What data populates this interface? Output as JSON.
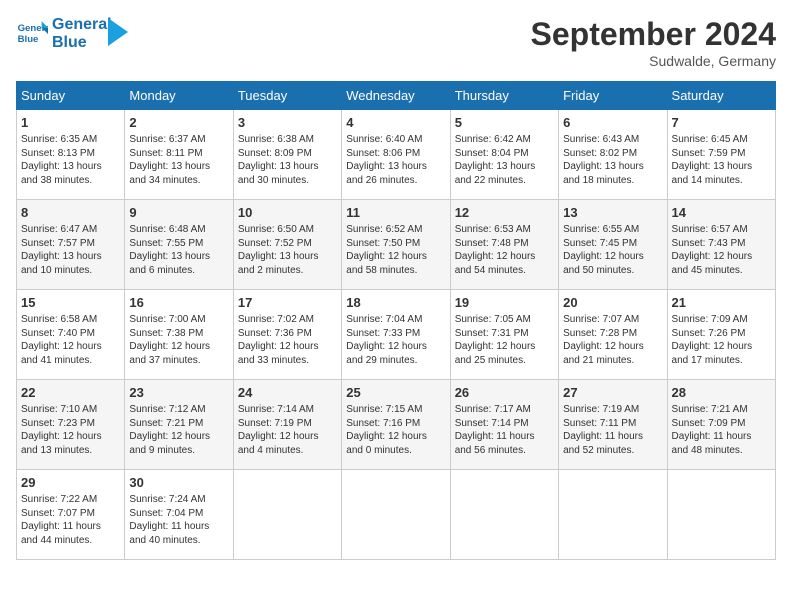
{
  "header": {
    "logo_line1": "General",
    "logo_line2": "Blue",
    "month": "September 2024",
    "location": "Sudwalde, Germany"
  },
  "weekdays": [
    "Sunday",
    "Monday",
    "Tuesday",
    "Wednesday",
    "Thursday",
    "Friday",
    "Saturday"
  ],
  "weeks": [
    [
      {
        "day": "1",
        "lines": [
          "Sunrise: 6:35 AM",
          "Sunset: 8:13 PM",
          "Daylight: 13 hours",
          "and 38 minutes."
        ]
      },
      {
        "day": "2",
        "lines": [
          "Sunrise: 6:37 AM",
          "Sunset: 8:11 PM",
          "Daylight: 13 hours",
          "and 34 minutes."
        ]
      },
      {
        "day": "3",
        "lines": [
          "Sunrise: 6:38 AM",
          "Sunset: 8:09 PM",
          "Daylight: 13 hours",
          "and 30 minutes."
        ]
      },
      {
        "day": "4",
        "lines": [
          "Sunrise: 6:40 AM",
          "Sunset: 8:06 PM",
          "Daylight: 13 hours",
          "and 26 minutes."
        ]
      },
      {
        "day": "5",
        "lines": [
          "Sunrise: 6:42 AM",
          "Sunset: 8:04 PM",
          "Daylight: 13 hours",
          "and 22 minutes."
        ]
      },
      {
        "day": "6",
        "lines": [
          "Sunrise: 6:43 AM",
          "Sunset: 8:02 PM",
          "Daylight: 13 hours",
          "and 18 minutes."
        ]
      },
      {
        "day": "7",
        "lines": [
          "Sunrise: 6:45 AM",
          "Sunset: 7:59 PM",
          "Daylight: 13 hours",
          "and 14 minutes."
        ]
      }
    ],
    [
      {
        "day": "8",
        "lines": [
          "Sunrise: 6:47 AM",
          "Sunset: 7:57 PM",
          "Daylight: 13 hours",
          "and 10 minutes."
        ]
      },
      {
        "day": "9",
        "lines": [
          "Sunrise: 6:48 AM",
          "Sunset: 7:55 PM",
          "Daylight: 13 hours",
          "and 6 minutes."
        ]
      },
      {
        "day": "10",
        "lines": [
          "Sunrise: 6:50 AM",
          "Sunset: 7:52 PM",
          "Daylight: 13 hours",
          "and 2 minutes."
        ]
      },
      {
        "day": "11",
        "lines": [
          "Sunrise: 6:52 AM",
          "Sunset: 7:50 PM",
          "Daylight: 12 hours",
          "and 58 minutes."
        ]
      },
      {
        "day": "12",
        "lines": [
          "Sunrise: 6:53 AM",
          "Sunset: 7:48 PM",
          "Daylight: 12 hours",
          "and 54 minutes."
        ]
      },
      {
        "day": "13",
        "lines": [
          "Sunrise: 6:55 AM",
          "Sunset: 7:45 PM",
          "Daylight: 12 hours",
          "and 50 minutes."
        ]
      },
      {
        "day": "14",
        "lines": [
          "Sunrise: 6:57 AM",
          "Sunset: 7:43 PM",
          "Daylight: 12 hours",
          "and 45 minutes."
        ]
      }
    ],
    [
      {
        "day": "15",
        "lines": [
          "Sunrise: 6:58 AM",
          "Sunset: 7:40 PM",
          "Daylight: 12 hours",
          "and 41 minutes."
        ]
      },
      {
        "day": "16",
        "lines": [
          "Sunrise: 7:00 AM",
          "Sunset: 7:38 PM",
          "Daylight: 12 hours",
          "and 37 minutes."
        ]
      },
      {
        "day": "17",
        "lines": [
          "Sunrise: 7:02 AM",
          "Sunset: 7:36 PM",
          "Daylight: 12 hours",
          "and 33 minutes."
        ]
      },
      {
        "day": "18",
        "lines": [
          "Sunrise: 7:04 AM",
          "Sunset: 7:33 PM",
          "Daylight: 12 hours",
          "and 29 minutes."
        ]
      },
      {
        "day": "19",
        "lines": [
          "Sunrise: 7:05 AM",
          "Sunset: 7:31 PM",
          "Daylight: 12 hours",
          "and 25 minutes."
        ]
      },
      {
        "day": "20",
        "lines": [
          "Sunrise: 7:07 AM",
          "Sunset: 7:28 PM",
          "Daylight: 12 hours",
          "and 21 minutes."
        ]
      },
      {
        "day": "21",
        "lines": [
          "Sunrise: 7:09 AM",
          "Sunset: 7:26 PM",
          "Daylight: 12 hours",
          "and 17 minutes."
        ]
      }
    ],
    [
      {
        "day": "22",
        "lines": [
          "Sunrise: 7:10 AM",
          "Sunset: 7:23 PM",
          "Daylight: 12 hours",
          "and 13 minutes."
        ]
      },
      {
        "day": "23",
        "lines": [
          "Sunrise: 7:12 AM",
          "Sunset: 7:21 PM",
          "Daylight: 12 hours",
          "and 9 minutes."
        ]
      },
      {
        "day": "24",
        "lines": [
          "Sunrise: 7:14 AM",
          "Sunset: 7:19 PM",
          "Daylight: 12 hours",
          "and 4 minutes."
        ]
      },
      {
        "day": "25",
        "lines": [
          "Sunrise: 7:15 AM",
          "Sunset: 7:16 PM",
          "Daylight: 12 hours",
          "and 0 minutes."
        ]
      },
      {
        "day": "26",
        "lines": [
          "Sunrise: 7:17 AM",
          "Sunset: 7:14 PM",
          "Daylight: 11 hours",
          "and 56 minutes."
        ]
      },
      {
        "day": "27",
        "lines": [
          "Sunrise: 7:19 AM",
          "Sunset: 7:11 PM",
          "Daylight: 11 hours",
          "and 52 minutes."
        ]
      },
      {
        "day": "28",
        "lines": [
          "Sunrise: 7:21 AM",
          "Sunset: 7:09 PM",
          "Daylight: 11 hours",
          "and 48 minutes."
        ]
      }
    ],
    [
      {
        "day": "29",
        "lines": [
          "Sunrise: 7:22 AM",
          "Sunset: 7:07 PM",
          "Daylight: 11 hours",
          "and 44 minutes."
        ]
      },
      {
        "day": "30",
        "lines": [
          "Sunrise: 7:24 AM",
          "Sunset: 7:04 PM",
          "Daylight: 11 hours",
          "and 40 minutes."
        ]
      },
      {
        "day": "",
        "lines": []
      },
      {
        "day": "",
        "lines": []
      },
      {
        "day": "",
        "lines": []
      },
      {
        "day": "",
        "lines": []
      },
      {
        "day": "",
        "lines": []
      }
    ]
  ]
}
